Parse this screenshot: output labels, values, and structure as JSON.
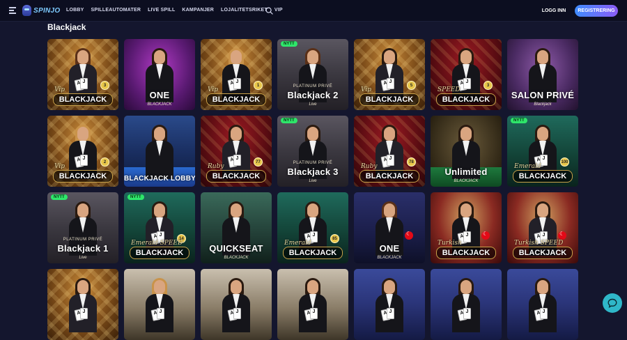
{
  "header": {
    "logo_text": "SPINJO",
    "nav": [
      "LOBBY",
      "SPILLEAUTOMATER",
      "LIVE SPILL",
      "KAMPANJER",
      "LOJALITETSRIKET",
      "VIP"
    ],
    "login_label": "LOGG INN",
    "register_label": "REGISTRERING"
  },
  "section": {
    "title": "Blackjack"
  },
  "games": [
    {
      "pre": "Vip",
      "title": "BLACKJACK",
      "badge_num": "3",
      "new": false,
      "theme": "th-gold",
      "hair": "hair-brown",
      "suit": "suit-vest",
      "style": "plate"
    },
    {
      "pre": "",
      "title": "ONE",
      "sub": "BLACKJACK",
      "new": false,
      "theme": "th-purple",
      "hair": "hair-dark",
      "suit": "suit-black",
      "style": "big"
    },
    {
      "pre": "Vip",
      "title": "BLACKJACK",
      "badge_num": "1",
      "new": false,
      "theme": "th-gold",
      "hair": "hair-blonde",
      "suit": "suit-black",
      "style": "plate"
    },
    {
      "pre": "PLATINUM PRIVÉ",
      "title": "Blackjack 2",
      "sub": "Live",
      "new": true,
      "new_label": "NYTT",
      "theme": "th-studio",
      "hair": "hair-brown",
      "suit": "suit-black",
      "style": "big"
    },
    {
      "pre": "Vip",
      "title": "BLACKJACK",
      "badge_num": "5",
      "new": false,
      "theme": "th-gold",
      "hair": "hair-dark",
      "suit": "suit-vest",
      "style": "plate"
    },
    {
      "pre": "SPEED",
      "title": "BLACKJACK",
      "badge_num": "3",
      "new": false,
      "theme": "th-red",
      "hair": "hair-dark",
      "suit": "suit-black",
      "style": "plate"
    },
    {
      "pre": "",
      "title": "SALON PRIVÉ",
      "sub": "Blackjack",
      "new": false,
      "theme": "th-salon",
      "hair": "hair-dark",
      "suit": "suit-black",
      "style": "big"
    },
    {
      "pre": "Vip",
      "title": "BLACKJACK",
      "badge_num": "2",
      "new": false,
      "theme": "th-gold",
      "hair": "hair-blonde",
      "suit": "suit-black",
      "style": "plate"
    },
    {
      "pre": "",
      "title": "BLACKJACK LOBBY",
      "new": false,
      "theme": "th-blue",
      "hair": "hair-dark",
      "suit": "suit-black",
      "style": "lobby",
      "strip": "strip-blue"
    },
    {
      "pre": "Ruby",
      "title": "BLACKJACK",
      "badge_num": "77",
      "new": false,
      "theme": "th-red",
      "hair": "hair-dark",
      "suit": "suit-vest",
      "style": "plate"
    },
    {
      "pre": "PLATINUM PRIVÉ",
      "title": "Blackjack 3",
      "sub": "Live",
      "new": true,
      "new_label": "NYTT",
      "theme": "th-studio",
      "hair": "hair-dark",
      "suit": "suit-black",
      "style": "big"
    },
    {
      "pre": "Ruby",
      "title": "BLACKJACK",
      "badge_num": "78",
      "new": false,
      "theme": "th-red",
      "hair": "hair-dark",
      "suit": "suit-vest",
      "style": "plate"
    },
    {
      "pre": "",
      "title": "Unlimited",
      "sub": "BLACKJACK",
      "new": false,
      "theme": "th-darkgold",
      "hair": "hair-dark",
      "suit": "suit-black",
      "style": "big",
      "strip": "strip-green"
    },
    {
      "pre": "Emerald",
      "title": "BLACKJACK",
      "badge_num": "100",
      "new": true,
      "new_label": "NYTT",
      "theme": "th-teal",
      "hair": "hair-dark",
      "suit": "suit-black",
      "style": "plate"
    },
    {
      "pre": "PLATINUM PRIVÉ",
      "title": "Blackjack 1",
      "sub": "Live",
      "new": true,
      "new_label": "NYTT",
      "theme": "th-studio",
      "hair": "hair-dark",
      "suit": "suit-black",
      "style": "big"
    },
    {
      "pre": "Emerald SPEED",
      "title": "BLACKJACK",
      "badge_num": "14",
      "new": true,
      "new_label": "NYTT",
      "theme": "th-teal",
      "hair": "hair-dark",
      "suit": "suit-vest",
      "style": "plate"
    },
    {
      "pre": "",
      "title": "QUICKSEAT",
      "sub": "BLACKJACK",
      "new": false,
      "theme": "th-mint",
      "hair": "hair-dark",
      "suit": "suit-black",
      "style": "big"
    },
    {
      "pre": "Emerald",
      "title": "BLACKJACK",
      "badge_num": "85",
      "new": false,
      "theme": "th-teal",
      "hair": "hair-dark",
      "suit": "suit-black",
      "style": "plate"
    },
    {
      "pre": "",
      "title": "ONE",
      "sub": "BLACKJACK",
      "new": false,
      "theme": "th-navy",
      "hair": "hair-brown",
      "suit": "suit-black",
      "style": "big",
      "flag": true
    },
    {
      "pre": "Turkish",
      "title": "BLACKJACK",
      "new": false,
      "theme": "th-arch",
      "hair": "hair-dark",
      "suit": "suit-black",
      "style": "plate",
      "flag": true
    },
    {
      "pre": "Turkish SPEED",
      "title": "BLACKJACK",
      "new": false,
      "theme": "th-arch",
      "hair": "hair-dark",
      "suit": "suit-vest",
      "style": "plate",
      "flag": true
    },
    {
      "pre": "",
      "title": "",
      "new": false,
      "theme": "th-gold",
      "hair": "hair-dark",
      "suit": "suit-vest",
      "style": "none"
    },
    {
      "pre": "",
      "title": "",
      "new": false,
      "theme": "th-marble",
      "hair": "hair-blonde",
      "suit": "suit-black",
      "style": "none"
    },
    {
      "pre": "",
      "title": "",
      "new": false,
      "theme": "th-marble",
      "hair": "hair-dark",
      "suit": "suit-black",
      "style": "none"
    },
    {
      "pre": "",
      "title": "",
      "new": false,
      "theme": "th-marble",
      "hair": "hair-dark",
      "suit": "suit-black",
      "style": "none"
    },
    {
      "pre": "",
      "title": "",
      "new": false,
      "theme": "th-bluefelt",
      "hair": "hair-dark",
      "suit": "suit-black",
      "style": "none"
    },
    {
      "pre": "",
      "title": "",
      "new": false,
      "theme": "th-bluefelt",
      "hair": "hair-dark",
      "suit": "suit-black",
      "style": "none"
    },
    {
      "pre": "",
      "title": "",
      "new": false,
      "theme": "th-bluefelt",
      "hair": "hair-dark",
      "suit": "suit-black",
      "style": "none"
    }
  ],
  "icons": {
    "menu": "hamburger-menu-icon",
    "search": "search-icon",
    "chat": "chat-bubble-icon"
  },
  "colors": {
    "background": "#14162e",
    "header": "#0c0e20",
    "register_gradient_start": "#3f8cff",
    "register_gradient_end": "#8b5cf6",
    "new_badge": "#2ee66a",
    "chat_button": "#2fb7c9"
  }
}
